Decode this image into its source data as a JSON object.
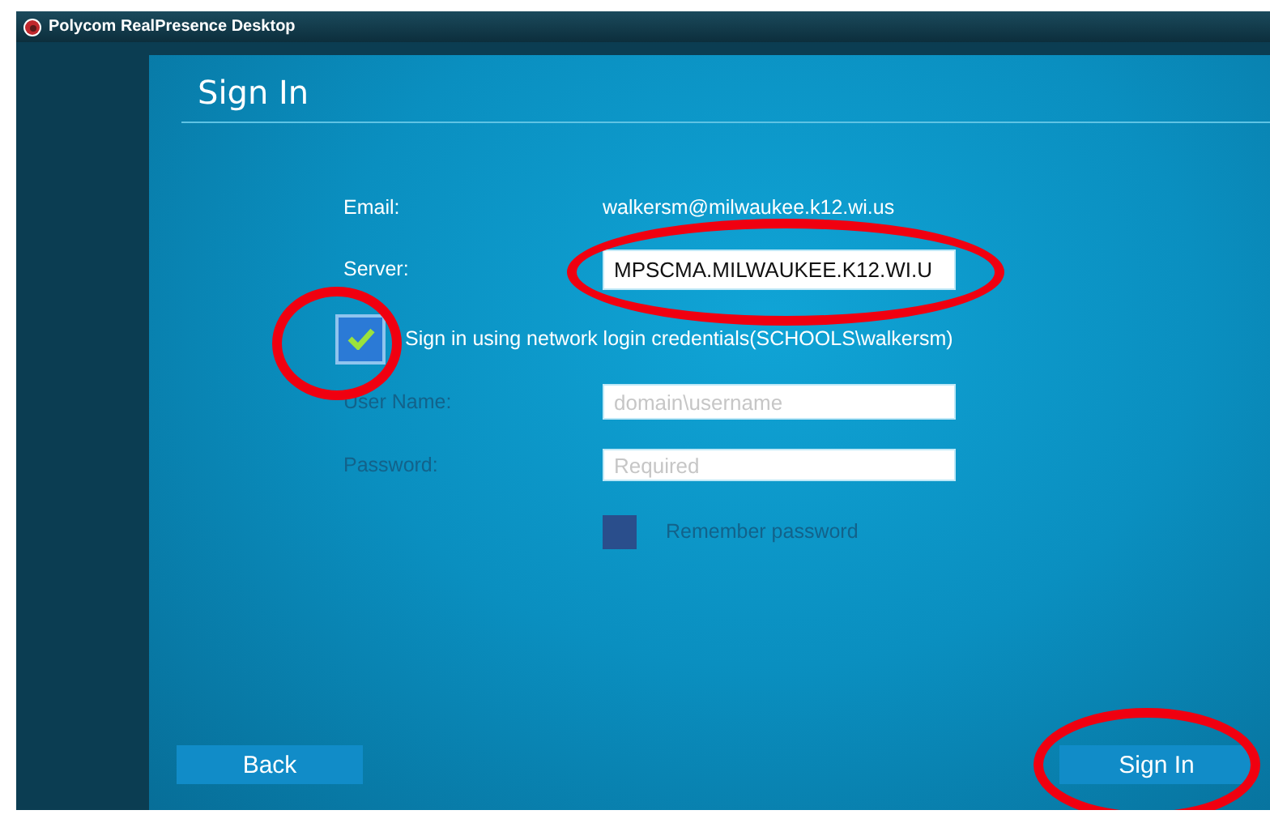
{
  "window": {
    "title": "Polycom RealPresence Desktop"
  },
  "heading": "Sign In",
  "email": {
    "label": "Email:",
    "value": "walkersm@milwaukee.k12.wi.us"
  },
  "server": {
    "label": "Server:",
    "value": "MPSCMA.MILWAUKEE.K12.WI.U"
  },
  "network_login": {
    "label": "Sign in using network login credentials(SCHOOLS\\walkersm)",
    "checked": true
  },
  "user_name": {
    "label": "User Name:",
    "placeholder": "domain\\username",
    "disabled": true
  },
  "password": {
    "label": "Password:",
    "placeholder": "Required",
    "disabled": true
  },
  "remember_password": {
    "label": "Remember password",
    "checked": false,
    "disabled": true
  },
  "buttons": [
    {
      "label": "Back",
      "kind": "back"
    },
    {
      "label": "Sign In",
      "kind": "primary"
    }
  ]
}
